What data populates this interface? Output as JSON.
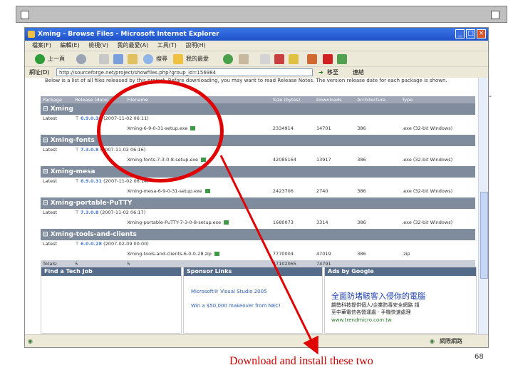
{
  "browser": {
    "title": "Xming - Browse Files - Microsoft Internet Explorer",
    "menu": [
      "檔案(F)",
      "編輯(E)",
      "檢視(V)",
      "我的最愛(A)",
      "工具(T)",
      "說明(H)"
    ],
    "toolbar": {
      "back": "上一頁",
      "search": "搜尋",
      "favorites": "我的最愛"
    },
    "address_label": "網址(D)",
    "address": "http://sourceforge.net/project/showfiles.php?group_id=156984",
    "go_label": "移至",
    "links_label": "連結"
  },
  "page": {
    "intro": "Below is a list of all files released by this project. Before downloading, you may want to read Release Notes. The version release date for each package is shown.",
    "columns": [
      "Package",
      "Release (date)",
      "Filename",
      "Size (bytes)",
      "Downloads",
      "Architecture",
      "Type"
    ],
    "packages": [
      {
        "name": "Xming",
        "release_label": "Latest",
        "release": "6.9.0.31",
        "date": "(2007-11-02 06:11)",
        "file": "Xming-6-9-0-31-setup.exe",
        "size": "2334914",
        "downloads": "14701",
        "arch": "386",
        "type": ".exe (32-bit Windows)"
      },
      {
        "name": "Xming-fonts",
        "release_label": "Latest",
        "release": "7.3.0.8",
        "date": "(2007-11-02 06:16)",
        "file": "Xming-fonts-7-3-0-8-setup.exe",
        "size": "42085164",
        "downloads": "13917",
        "arch": "386",
        "type": ".exe (32-bit Windows)"
      },
      {
        "name": "Xming-mesa",
        "release_label": "Latest",
        "release": "6.9.0.31",
        "date": "(2007-11-02 06:14)",
        "file": "Xming-mesa-6-9-0-31-setup.exe",
        "size": "2423706",
        "downloads": "2740",
        "arch": "386",
        "type": ".exe (32-bit Windows)"
      },
      {
        "name": "Xming-portable-PuTTY",
        "release_label": "Latest",
        "release": "7.3.0.8",
        "date": "(2007-11-02 06:17)",
        "file": "Xming-portable-PuTTY-7-3-0-8-setup.exe",
        "size": "1680073",
        "downloads": "3314",
        "arch": "386",
        "type": ".exe (32-bit Windows)"
      },
      {
        "name": "Xming-tools-and-clients",
        "release_label": "Latest",
        "release": "6.0.0.28",
        "date": "(2007-02-09 00:00)",
        "file": "Xming-tools-and-clients-6-0-0-28.zip",
        "size": "7770004",
        "downloads": "47019",
        "arch": "386",
        "type": ".zip"
      }
    ],
    "totals": {
      "label": "Totals:",
      "packages": "5",
      "releases": "5",
      "size": "47102065",
      "downloads": "74791"
    },
    "job_header": "Find a Tech Job",
    "sponsor_header": "Sponsor Links",
    "sponsor_links": [
      "Microsoft® Visual Studio 2005",
      "Win a $50,000 makeover from NEC!"
    ],
    "ads_header": "Ads by Google",
    "ad_title": "全面防堵駭客入侵你的電腦",
    "ad_line1": "趨勢科技提供個人/企業防毒安全網路 請",
    "ad_line2": "至中華電信各營運處 · 手機快速處理",
    "ad_url": "www.trendmicro.com.tw"
  },
  "status": {
    "zone": "網際網路"
  },
  "slide": {
    "caption": "Download and install these two",
    "page_number": "68"
  },
  "colors": {
    "annotation": "#e00000",
    "caption": "#cc0000"
  }
}
